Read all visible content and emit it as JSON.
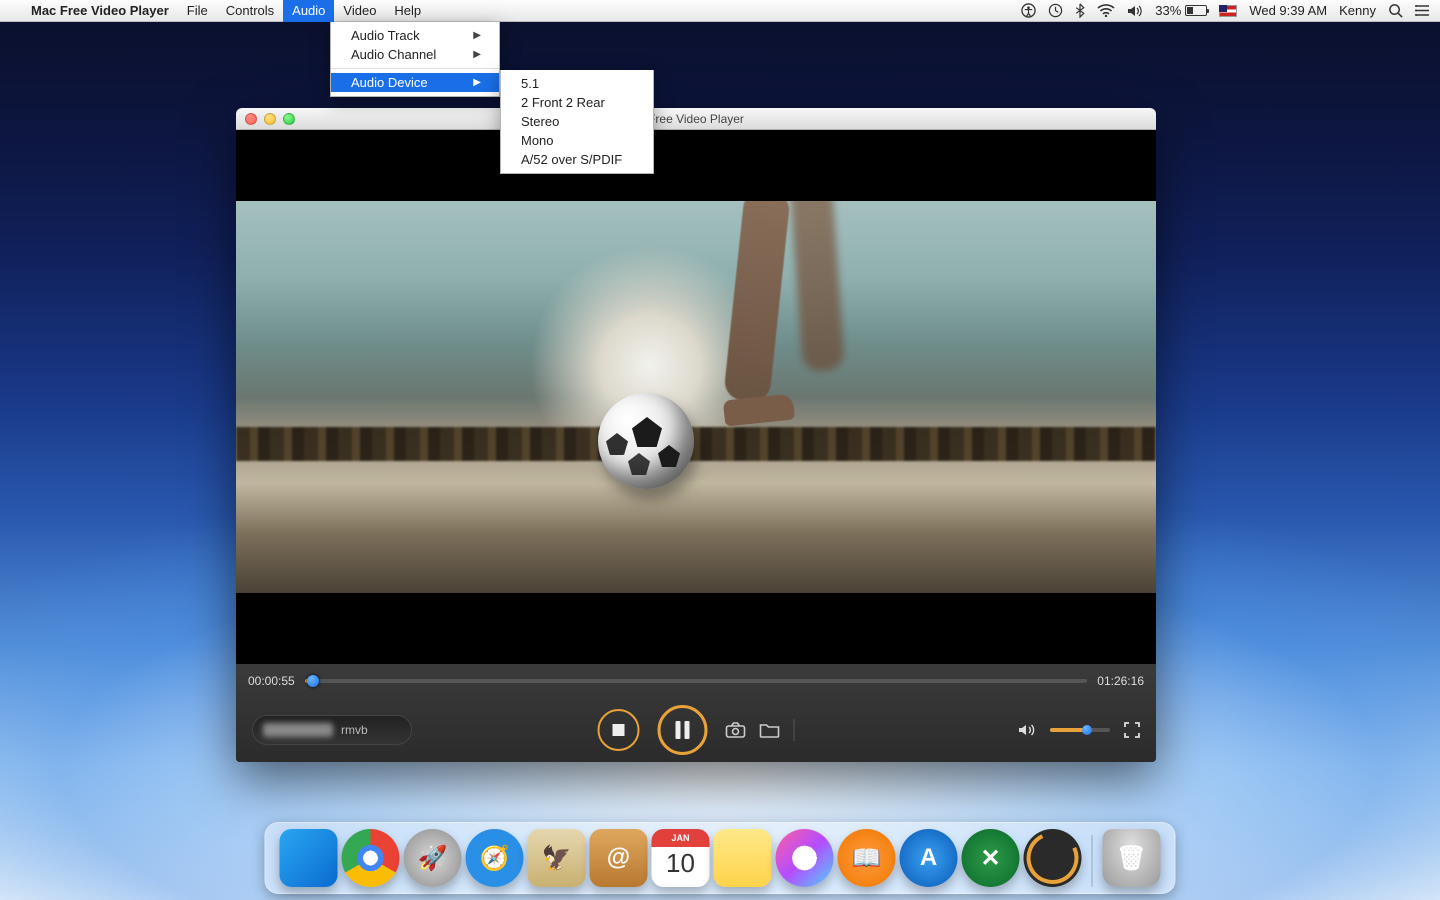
{
  "menubar": {
    "app_name": "Mac Free Video Player",
    "items": [
      "File",
      "Controls",
      "Audio",
      "Video",
      "Help"
    ],
    "open_index": 2,
    "right": {
      "battery_percent": "33%",
      "datetime": "Wed 9:39 AM",
      "user": "Kenny"
    }
  },
  "audio_menu": {
    "items": [
      {
        "label": "Audio Track",
        "submenu": true
      },
      {
        "label": "Audio Channel",
        "submenu": true
      },
      {
        "label": "Audio Device",
        "submenu": true,
        "highlight": true
      }
    ]
  },
  "audio_device_submenu": {
    "items": [
      "5.1",
      "2 Front 2 Rear",
      "Stereo",
      "Mono",
      "A/52 over S/PDIF"
    ]
  },
  "player": {
    "title": "Free Video Player",
    "time_current": "00:00:55",
    "time_total": "01:26:16",
    "now_playing_ext": "rmvb"
  },
  "dock": {
    "calendar_month": "JAN",
    "calendar_day": "10"
  }
}
